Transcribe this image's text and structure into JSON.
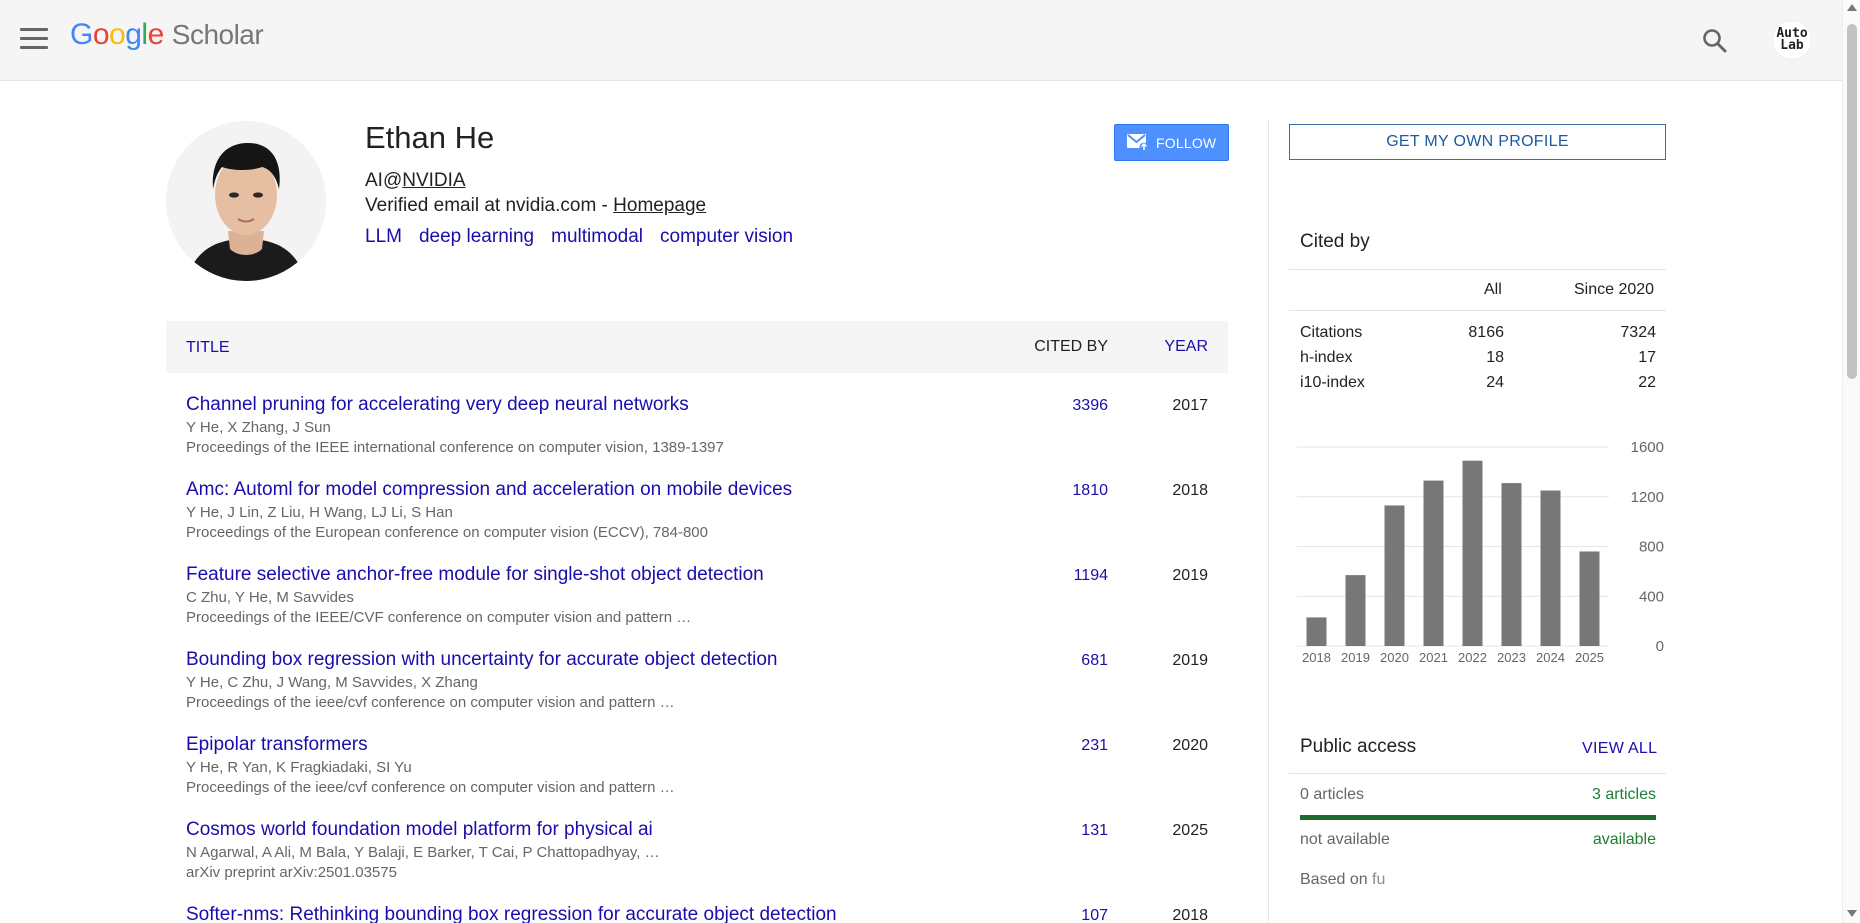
{
  "header": {
    "logo_google": [
      "G",
      "o",
      "o",
      "g",
      "l",
      "e"
    ],
    "logo_scholar": "Scholar",
    "account_line1": "Auto",
    "account_line2": "Lab"
  },
  "profile": {
    "name": "Ethan He",
    "affiliation_prefix": "AI@",
    "affiliation_link": "NVIDIA",
    "email_text": "Verified email at nvidia.com - ",
    "homepage_link": "Homepage",
    "interests": [
      "LLM",
      "deep learning",
      "multimodal",
      "computer vision"
    ],
    "follow_label": "FOLLOW"
  },
  "table": {
    "col_title": "TITLE",
    "col_cited_by": "CITED BY",
    "col_year": "YEAR",
    "rows": [
      {
        "title": "Channel pruning for accelerating very deep neural networks",
        "authors": "Y He, X Zhang, J Sun",
        "venue": "Proceedings of the IEEE international conference on computer vision, 1389-1397",
        "cited_by": "3396",
        "year": "2017"
      },
      {
        "title": "Amc: Automl for model compression and acceleration on mobile devices",
        "authors": "Y He, J Lin, Z Liu, H Wang, LJ Li, S Han",
        "venue": "Proceedings of the European conference on computer vision (ECCV), 784-800",
        "cited_by": "1810",
        "year": "2018"
      },
      {
        "title": "Feature selective anchor-free module for single-shot object detection",
        "authors": "C Zhu, Y He, M Savvides",
        "venue": "Proceedings of the IEEE/CVF conference on computer vision and pattern …",
        "cited_by": "1194",
        "year": "2019"
      },
      {
        "title": "Bounding box regression with uncertainty for accurate object detection",
        "authors": "Y He, C Zhu, J Wang, M Savvides, X Zhang",
        "venue": "Proceedings of the ieee/cvf conference on computer vision and pattern …",
        "cited_by": "681",
        "year": "2019"
      },
      {
        "title": "Epipolar transformers",
        "authors": "Y He, R Yan, K Fragkiadaki, SI Yu",
        "venue": "Proceedings of the ieee/cvf conference on computer vision and pattern …",
        "cited_by": "231",
        "year": "2020"
      },
      {
        "title": "Cosmos world foundation model platform for physical ai",
        "authors": "N Agarwal, A Ali, M Bala, Y Balaji, E Barker, T Cai, P Chattopadhyay, …",
        "venue": "arXiv preprint arXiv:2501.03575",
        "cited_by": "131",
        "year": "2025"
      },
      {
        "title": "Softer-nms: Rethinking bounding box regression for accurate object detection",
        "authors": "",
        "venue": "",
        "cited_by": "107",
        "year": "2018"
      }
    ]
  },
  "sidebar": {
    "get_profile_label": "GET MY OWN PROFILE",
    "cited_by_title": "Cited by",
    "col_all": "All",
    "col_since": "Since 2020",
    "stats": [
      {
        "label": "Citations",
        "all": "8166",
        "since": "7324"
      },
      {
        "label": "h-index",
        "all": "18",
        "since": "17"
      },
      {
        "label": "i10-index",
        "all": "24",
        "since": "22"
      }
    ],
    "public_access_title": "Public access",
    "view_all_label": "VIEW ALL",
    "not_available_count": "0 articles",
    "available_count": "3 articles",
    "not_available_label": "not available",
    "available_label": "available",
    "based_on": "Based on fu"
  },
  "chart_data": {
    "type": "bar",
    "categories": [
      "2018",
      "2019",
      "2020",
      "2021",
      "2022",
      "2023",
      "2024",
      "2025"
    ],
    "values": [
      230,
      570,
      1130,
      1330,
      1490,
      1310,
      1250,
      760
    ],
    "ylim": [
      0,
      1600
    ],
    "yticks": [
      0,
      400,
      800,
      1200,
      1600
    ],
    "bar_color": "#777777",
    "grid": true
  },
  "colors": {
    "link": "#1a0dab",
    "follow_bg": "#4d90fe",
    "public_access_bar": "#1e6b2e"
  }
}
